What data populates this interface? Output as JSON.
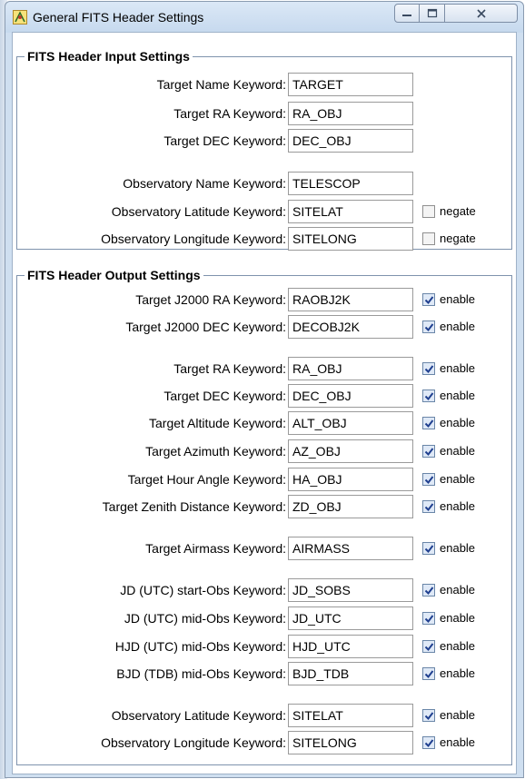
{
  "window": {
    "title": "General FITS Header Settings"
  },
  "input": {
    "title": "FITS Header Input Settings",
    "rows": [
      {
        "label": "Target Name Keyword:",
        "value": "TARGET"
      },
      {
        "label": "Target RA Keyword:",
        "value": "RA_OBJ"
      },
      {
        "label": "Target DEC Keyword:",
        "value": "DEC_OBJ"
      },
      {
        "label": "Observatory Name Keyword:",
        "value": "TELESCOP"
      },
      {
        "label": "Observatory Latitude Keyword:",
        "value": "SITELAT",
        "check_label": "negate",
        "checked": false
      },
      {
        "label": "Observatory Longitude Keyword:",
        "value": "SITELONG",
        "check_label": "negate",
        "checked": false
      }
    ]
  },
  "output": {
    "title": "FITS Header Output Settings",
    "rows": [
      {
        "label": "Target J2000 RA Keyword:",
        "value": "RAOBJ2K",
        "check_label": "enable",
        "checked": true
      },
      {
        "label": "Target J2000 DEC Keyword:",
        "value": "DECOBJ2K",
        "check_label": "enable",
        "checked": true
      },
      {
        "label": "Target RA Keyword:",
        "value": "RA_OBJ",
        "check_label": "enable",
        "checked": true
      },
      {
        "label": "Target DEC Keyword:",
        "value": "DEC_OBJ",
        "check_label": "enable",
        "checked": true
      },
      {
        "label": "Target Altitude Keyword:",
        "value": "ALT_OBJ",
        "check_label": "enable",
        "checked": true
      },
      {
        "label": "Target Azimuth Keyword:",
        "value": "AZ_OBJ",
        "check_label": "enable",
        "checked": true
      },
      {
        "label": "Target Hour Angle Keyword:",
        "value": "HA_OBJ",
        "check_label": "enable",
        "checked": true
      },
      {
        "label": "Target Zenith Distance Keyword:",
        "value": "ZD_OBJ",
        "check_label": "enable",
        "checked": true
      },
      {
        "label": "Target Airmass Keyword:",
        "value": "AIRMASS",
        "check_label": "enable",
        "checked": true
      },
      {
        "label": "JD (UTC) start-Obs Keyword:",
        "value": "JD_SOBS",
        "check_label": "enable",
        "checked": true
      },
      {
        "label": "JD (UTC) mid-Obs Keyword:",
        "value": "JD_UTC",
        "check_label": "enable",
        "checked": true
      },
      {
        "label": "HJD (UTC) mid-Obs Keyword:",
        "value": "HJD_UTC",
        "check_label": "enable",
        "checked": true
      },
      {
        "label": "BJD (TDB) mid-Obs Keyword:",
        "value": "BJD_TDB",
        "check_label": "enable",
        "checked": true
      },
      {
        "label": "Observatory Latitude Keyword:",
        "value": "SITELAT",
        "check_label": "enable",
        "checked": true
      },
      {
        "label": "Observatory Longitude Keyword:",
        "value": "SITELONG",
        "check_label": "enable",
        "checked": true
      }
    ]
  }
}
